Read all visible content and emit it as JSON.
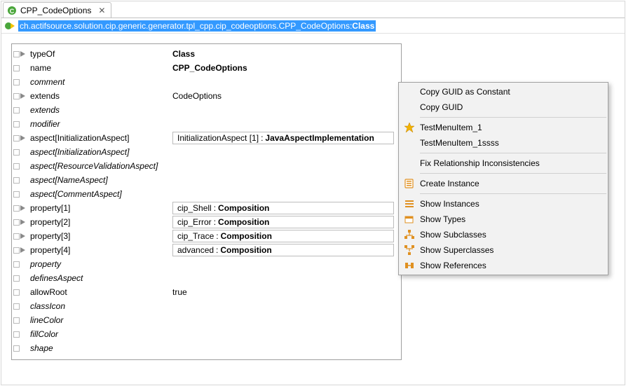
{
  "tab": {
    "title": "CPP_CodeOptions"
  },
  "breadcrumb": {
    "path_prefix": "ch.actifsource.solution.cip.generic.generator.tpl_cpp.cip_codeoptions.CPP_CodeOptions:",
    "path_type": "Class"
  },
  "rows": {
    "typeOf": {
      "label": "typeOf",
      "value": "Class"
    },
    "name": {
      "label": "name",
      "value": "CPP_CodeOptions"
    },
    "comment": {
      "label": "comment"
    },
    "extends": {
      "label": "extends",
      "value": "CodeOptions"
    },
    "extends2": {
      "label": "extends"
    },
    "modifier": {
      "label": "modifier"
    },
    "aspect1": {
      "label": "aspect[InitializationAspect]",
      "box1": "InitializationAspect [1]",
      "box2": "JavaAspectImplementation"
    },
    "aspect2": {
      "label": "aspect[InitializationAspect]"
    },
    "aspect3": {
      "label": "aspect[ResourceValidationAspect]"
    },
    "aspect4": {
      "label": "aspect[NameAspect]"
    },
    "aspect5": {
      "label": "aspect[CommentAspect]"
    },
    "prop1": {
      "label": "property[1]",
      "box1": "cip_Shell",
      "box2": "Composition"
    },
    "prop2": {
      "label": "property[2]",
      "box1": "cip_Error",
      "box2": "Composition"
    },
    "prop3": {
      "label": "property[3]",
      "box1": "cip_Trace",
      "box2": "Composition"
    },
    "prop4": {
      "label": "property[4]",
      "box1": "advanced",
      "box2": "Composition"
    },
    "property": {
      "label": "property"
    },
    "definesAspect": {
      "label": "definesAspect"
    },
    "allowRoot": {
      "label": "allowRoot",
      "value": "true"
    },
    "classIcon": {
      "label": "classIcon"
    },
    "lineColor": {
      "label": "lineColor"
    },
    "fillColor": {
      "label": "fillColor"
    },
    "shape": {
      "label": "shape"
    }
  },
  "menu": {
    "copy_guid_const": "Copy GUID as Constant",
    "copy_guid": "Copy GUID",
    "testmenu1": "TestMenuItem_1",
    "testmenu1s": "TestMenuItem_1ssss",
    "fix_rel": "Fix Relationship Inconsistencies",
    "create_instance": "Create Instance",
    "show_instances": "Show Instances",
    "show_types": "Show Types",
    "show_subclasses": "Show Subclasses",
    "show_superclasses": "Show Superclasses",
    "show_references": "Show References"
  }
}
